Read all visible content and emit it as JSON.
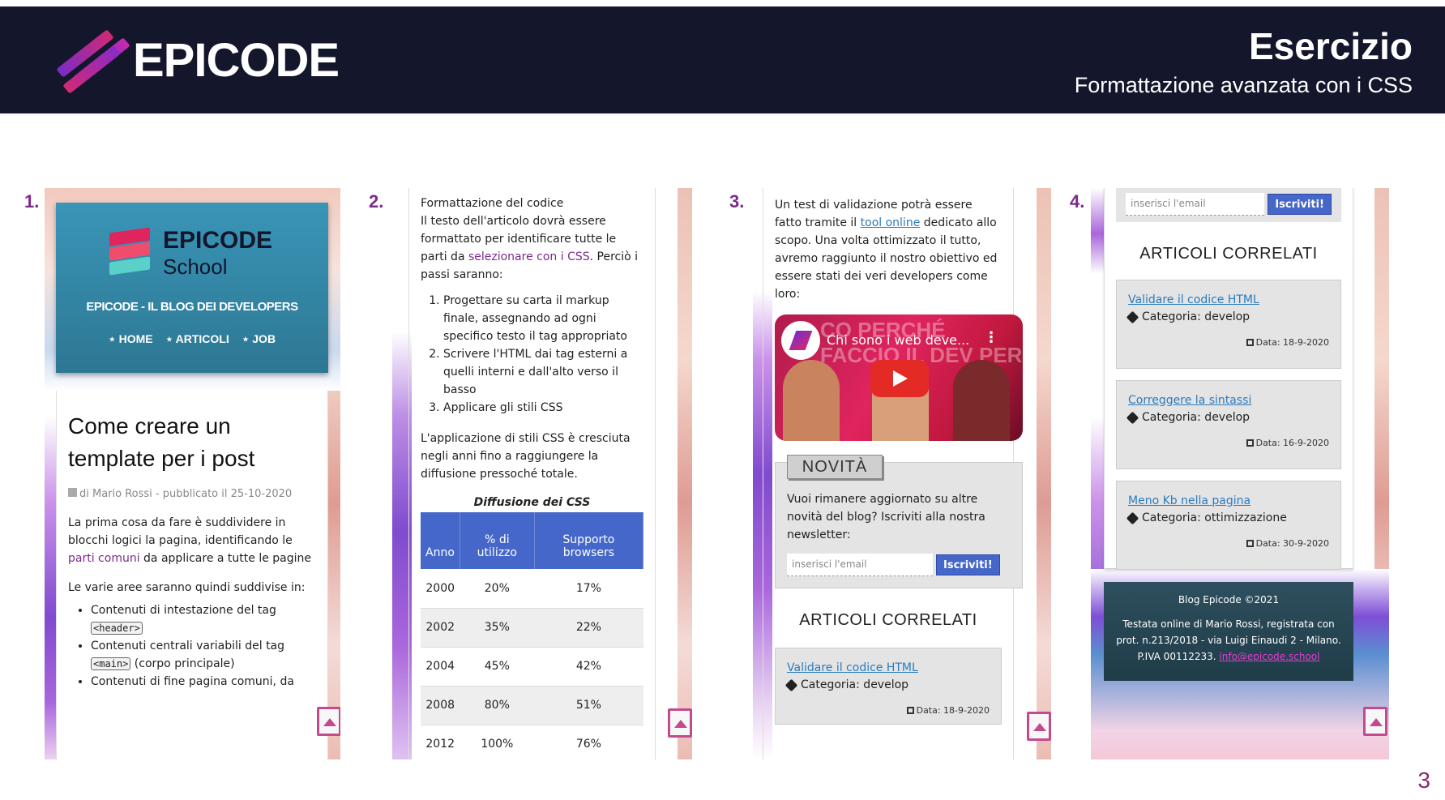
{
  "header": {
    "brand": "EPICODE",
    "title": "Esercizio",
    "subtitle": "Formattazione avanzata con i CSS"
  },
  "panels": {
    "p1": {
      "number": "1.",
      "brand": "EPICODE",
      "brand_sub": "School",
      "blog_title": "EPICODE - IL BLOG DEI DEVELOPERS",
      "nav": [
        "HOME",
        "ARTICOLI",
        "JOB"
      ],
      "article_title": "Come creare un template per i post",
      "meta": "di Mario Rossi - pubblicato il 25-10-2020",
      "para1_a": "La prima cosa da fare è suddividere in blocchi logici la pagina, identificando le ",
      "para1_hl": "parti comuni",
      "para1_b": " da applicare a tutte le pagine",
      "para2": "Le varie aree saranno quindi suddivise in:",
      "list": [
        {
          "a": "Contenuti di intestazione del tag ",
          "code": "<header>",
          "b": ""
        },
        {
          "a": "Contenuti centrali variabili del tag ",
          "code": "<main>",
          "b": " (corpo principale)"
        },
        {
          "a": "Contenuti di fine pagina comuni, da",
          "code": "",
          "b": ""
        }
      ]
    },
    "p2": {
      "number": "2.",
      "heading": "Formattazione del codice",
      "para_a": "Il testo dell'articolo dovrà essere formattato per identificare tutte le parti da ",
      "para_hl": "selezionare con i CSS",
      "para_b": ". Perciò i passi saranno:",
      "steps": [
        "Progettare su carta il markup finale, assegnando ad ogni specifico testo il tag appropriato",
        "Scrivere l'HTML dai tag esterni a quelli interni e dall'alto verso il basso",
        "Applicare gli stili CSS"
      ],
      "para2": "L'applicazione di stili CSS è cresciuta negli anni fino a raggiungere la diffusione pressoché totale.",
      "table_caption": "Diffusione dei CSS",
      "table_headers": [
        "Anno",
        "% di utilizzo",
        "Supporto browsers"
      ],
      "table_rows": [
        [
          "2000",
          "20%",
          "17%"
        ],
        [
          "2002",
          "35%",
          "22%"
        ],
        [
          "2004",
          "45%",
          "42%"
        ],
        [
          "2008",
          "80%",
          "51%"
        ],
        [
          "2012",
          "100%",
          "76%"
        ]
      ]
    },
    "p3": {
      "number": "3.",
      "para_a": "Un test di validazione potrà essere fatto tramite il ",
      "para_link": "tool online",
      "para_b": " dedicato allo scopo. Una volta ottimizzato il tutto, avremo raggiunto il nostro obiettivo ed essere stati dei veri developers come loro:",
      "video_title": "Chi sono i web deve...",
      "video_bg_text": "CO PERCHÉ FACCIO IL DEV PER",
      "news_tab": "NOVITÀ",
      "news_text": "Vuoi rimanere aggiornato su altre novità del blog? Iscriviti alla nostra newsletter:",
      "email_placeholder": "inserisci l'email",
      "subscribe_label": "Iscriviti!",
      "related_title": "ARTICOLI CORRELATI",
      "related": [
        {
          "title": "Validare il codice HTML",
          "category": "Categoria: develop",
          "date": "Data: 18-9-2020"
        }
      ]
    },
    "p4": {
      "number": "4.",
      "email_placeholder": "inserisci l'email",
      "subscribe_label": "Iscriviti!",
      "related_title": "ARTICOLI CORRELATI",
      "related": [
        {
          "title": "Validare il codice HTML",
          "category": "Categoria: develop",
          "date": "Data: 18-9-2020"
        },
        {
          "title": "Correggere la sintassi",
          "category": "Categoria: develop",
          "date": "Data: 16-9-2020"
        },
        {
          "title": "Meno Kb nella pagina",
          "category": "Categoria: ottimizzazione",
          "date": "Data: 30-9-2020"
        }
      ],
      "footer_line1": "Blog Epicode ©2021",
      "footer_line2": "Testata online di Mario Rossi, registrata con prot. n.213/2018 - via Luigi Einaudi 2 - Milano. P.IVA 00112233.",
      "footer_email": "info@epicode.school"
    }
  },
  "page_number": "3",
  "colors": {
    "header_bg": "#14162b",
    "accent_purple": "#7b2a8b",
    "table_header": "#4567c9",
    "link_blue": "#2b7bbf",
    "hero_teal": "#3a95b7"
  }
}
